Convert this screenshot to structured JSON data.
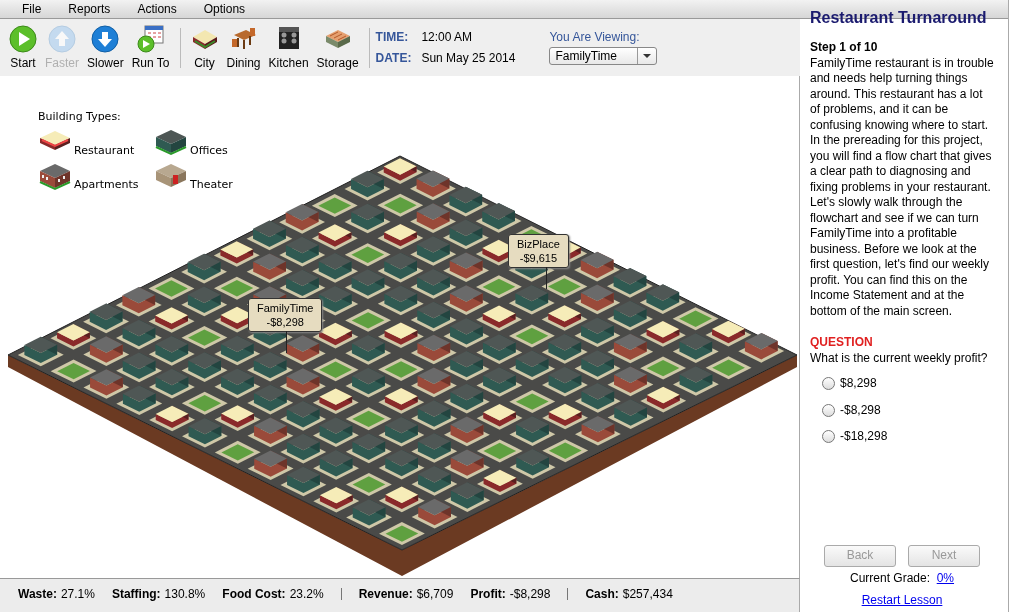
{
  "menu": [
    "File",
    "Reports",
    "Actions",
    "Options"
  ],
  "toolbar": {
    "sim_buttons": [
      {
        "kind": "start",
        "label": "Start",
        "disabled": false
      },
      {
        "kind": "faster",
        "label": "Faster",
        "disabled": true
      },
      {
        "kind": "slower",
        "label": "Slower",
        "disabled": false
      },
      {
        "kind": "runto",
        "label": "Run To",
        "disabled": false
      }
    ],
    "view_buttons": [
      {
        "kind": "city",
        "label": "City"
      },
      {
        "kind": "dining",
        "label": "Dining"
      },
      {
        "kind": "kitchen",
        "label": "Kitchen"
      },
      {
        "kind": "storage",
        "label": "Storage"
      }
    ],
    "time_label": "TIME:",
    "time": "12:00 AM",
    "date_label": "DATE:",
    "date": "Sun May 25 2014",
    "viewing_label": "You Are Viewing:",
    "viewing": "FamilyTime"
  },
  "map": {
    "legend_title": "Building Types:",
    "legend": [
      {
        "kind": "restaurant",
        "label": "Restaurant"
      },
      {
        "kind": "offices",
        "label": "Offices"
      },
      {
        "kind": "apartments",
        "label": "Apartments"
      },
      {
        "kind": "theater",
        "label": "Theater"
      }
    ],
    "callouts": [
      {
        "name": "FamilyTime",
        "amount": "-$8,298"
      },
      {
        "name": "BizPlace",
        "amount": "-$9,615"
      }
    ]
  },
  "status_bar": [
    [
      {
        "label": "Waste:",
        "value": "27.1%"
      },
      {
        "label": "Staffing:",
        "value": "130.8%"
      },
      {
        "label": "Food Cost:",
        "value": "23.2%"
      }
    ],
    [
      {
        "label": "Revenue:",
        "value": "$6,709"
      },
      {
        "label": "Profit:",
        "value": "-$8,298"
      }
    ],
    [
      {
        "label": "Cash:",
        "value": "$257,434"
      }
    ]
  ],
  "lesson": {
    "title": "Restaurant Turnaround",
    "step": "Step 1 of 10",
    "text": "FamilyTime restaurant is in trouble and needs help turning things around. This restaurant has a lot of problems, and it can be confusing knowing where to start. In the prereading for this project, you will find a flow chart that gives a clear path to diagnosing and fixing problems in your restaurant. Let's slowly walk through the flowchart and see if we can turn FamilyTime into a profitable business. Before we look at the first question, let's find our weekly profit. You can find this on the Income Statement and at the bottom of the main screen.",
    "question_label": "QUESTION",
    "question": "What is the current weekly profit?",
    "options": [
      {
        "label": "$8,298",
        "selected": false
      },
      {
        "label": "-$8,298",
        "selected": false
      },
      {
        "label": "-$18,298",
        "selected": false
      }
    ],
    "buttons": [
      {
        "label": "Back",
        "disabled": true
      },
      {
        "label": "Next",
        "disabled": true
      }
    ],
    "grade_label": "Current Grade:",
    "grade": "0%",
    "restart": "Restart Lesson"
  }
}
